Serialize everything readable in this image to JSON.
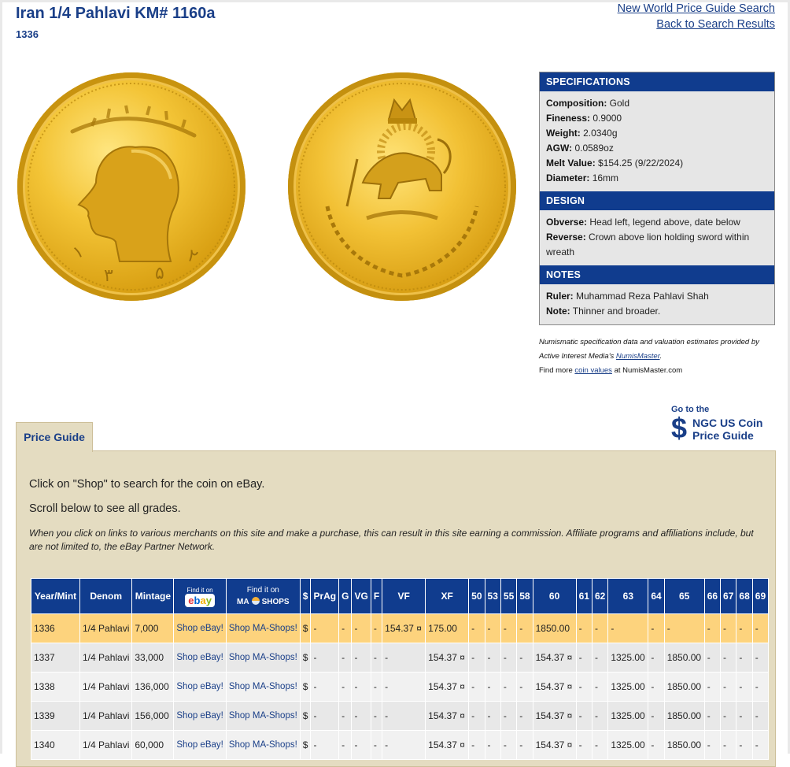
{
  "header": {
    "title": "Iran 1/4 Pahlavi KM# 1160a",
    "subtitle": "1336",
    "links": [
      "New World Price Guide Search",
      "Back to Search Results"
    ]
  },
  "specs": {
    "specifications_head": "SPECIFICATIONS",
    "composition_label": "Composition:",
    "composition": "Gold",
    "fineness_label": "Fineness:",
    "fineness": "0.9000",
    "weight_label": "Weight:",
    "weight": "2.0340g",
    "agw_label": "AGW:",
    "agw": "0.0589oz",
    "melt_label": "Melt Value:",
    "melt": "$154.25 (9/22/2024)",
    "diameter_label": "Diameter:",
    "diameter": "16mm",
    "design_head": "DESIGN",
    "obverse_label": "Obverse:",
    "obverse": "Head left, legend above, date below",
    "reverse_label": "Reverse:",
    "reverse": "Crown above lion holding sword within wreath",
    "notes_head": "NOTES",
    "ruler_label": "Ruler:",
    "ruler": "Muhammad Reza Pahlavi Shah",
    "note_label": "Note:",
    "note": "Thinner and broader."
  },
  "credit": {
    "line1a": "Numismatic specification data and valuation estimates provided by Active Interest Media's ",
    "line1_link": "NumisMaster",
    "line1b": ".",
    "line2a": "Find more ",
    "line2_link": "coin values",
    "line2b": " at NumisMaster.com"
  },
  "ngc": {
    "go": "Go to the",
    "dollar": "$",
    "line1": "NGC US Coin",
    "line2": "Price Guide"
  },
  "tab": {
    "label": "Price Guide"
  },
  "panel": {
    "p1": "Click on \"Shop\" to search for the coin on eBay.",
    "p2": "Scroll below to see all grades.",
    "p3": "When you click on links to various merchants on this site and make a purchase, this can result in this site earning a commission. Affiliate programs and affiliations include, but are not limited to, the eBay Partner Network."
  },
  "table": {
    "headers": {
      "year": "Year/Mint",
      "denom": "Denom",
      "mintage": "Mintage",
      "ebay_find": "Find it on",
      "ebay_e": "e",
      "ebay_b": "b",
      "ebay_a": "a",
      "ebay_y": "y",
      "ma_find": "Find it on",
      "ma_left": "MA",
      "ma_right": "SHOPS",
      "dollar": "$",
      "prag": "PrAg",
      "g": "G",
      "vg": "VG",
      "f": "F",
      "vf": "VF",
      "xf": "XF",
      "g50": "50",
      "g53": "53",
      "g55": "55",
      "g58": "58",
      "g60": "60",
      "g61": "61",
      "g62": "62",
      "g63": "63",
      "g64": "64",
      "g65": "65",
      "g66": "66",
      "g67": "67",
      "g68": "68",
      "g69": "69"
    },
    "rows": [
      {
        "year": "1336",
        "denom": "1/4 Pahlavi",
        "mintage": "7,000",
        "shop_ebay": "Shop eBay!",
        "shop_ma": "Shop MA-Shops!",
        "dollar": "$",
        "prag": "-",
        "g": "-",
        "vg": "-",
        "f": "-",
        "vf": "154.37 ¤",
        "xf": "175.00",
        "g50": "-",
        "g53": "-",
        "g55": "-",
        "g58": "-",
        "g60": "1850.00",
        "g61": "-",
        "g62": "-",
        "g63": "-",
        "g64": "-",
        "g65": "-",
        "g66": "-",
        "g67": "-",
        "g68": "-",
        "g69": "-"
      },
      {
        "year": "1337",
        "denom": "1/4 Pahlavi",
        "mintage": "33,000",
        "shop_ebay": "Shop eBay!",
        "shop_ma": "Shop MA-Shops!",
        "dollar": "$",
        "prag": "-",
        "g": "-",
        "vg": "-",
        "f": "-",
        "vf": "-",
        "xf": "154.37 ¤",
        "g50": "-",
        "g53": "-",
        "g55": "-",
        "g58": "-",
        "g60": "154.37 ¤",
        "g61": "-",
        "g62": "-",
        "g63": "1325.00",
        "g64": "-",
        "g65": "1850.00",
        "g66": "-",
        "g67": "-",
        "g68": "-",
        "g69": "-"
      },
      {
        "year": "1338",
        "denom": "1/4 Pahlavi",
        "mintage": "136,000",
        "shop_ebay": "Shop eBay!",
        "shop_ma": "Shop MA-Shops!",
        "dollar": "$",
        "prag": "-",
        "g": "-",
        "vg": "-",
        "f": "-",
        "vf": "-",
        "xf": "154.37 ¤",
        "g50": "-",
        "g53": "-",
        "g55": "-",
        "g58": "-",
        "g60": "154.37 ¤",
        "g61": "-",
        "g62": "-",
        "g63": "1325.00",
        "g64": "-",
        "g65": "1850.00",
        "g66": "-",
        "g67": "-",
        "g68": "-",
        "g69": "-"
      },
      {
        "year": "1339",
        "denom": "1/4 Pahlavi",
        "mintage": "156,000",
        "shop_ebay": "Shop eBay!",
        "shop_ma": "Shop MA-Shops!",
        "dollar": "$",
        "prag": "-",
        "g": "-",
        "vg": "-",
        "f": "-",
        "vf": "-",
        "xf": "154.37 ¤",
        "g50": "-",
        "g53": "-",
        "g55": "-",
        "g58": "-",
        "g60": "154.37 ¤",
        "g61": "-",
        "g62": "-",
        "g63": "1325.00",
        "g64": "-",
        "g65": "1850.00",
        "g66": "-",
        "g67": "-",
        "g68": "-",
        "g69": "-"
      },
      {
        "year": "1340",
        "denom": "1/4 Pahlavi",
        "mintage": "60,000",
        "shop_ebay": "Shop eBay!",
        "shop_ma": "Shop MA-Shops!",
        "dollar": "$",
        "prag": "-",
        "g": "-",
        "vg": "-",
        "f": "-",
        "vf": "-",
        "xf": "154.37 ¤",
        "g50": "-",
        "g53": "-",
        "g55": "-",
        "g58": "-",
        "g60": "154.37 ¤",
        "g61": "-",
        "g62": "-",
        "g63": "1325.00",
        "g64": "-",
        "g65": "1850.00",
        "g66": "-",
        "g67": "-",
        "g68": "-",
        "g69": "-"
      }
    ]
  },
  "colors": {
    "brand_blue": "#103c8e",
    "link_blue": "#1a3f88",
    "panel_tan": "#e4dcc1",
    "highlight_row": "#fdd37d"
  }
}
